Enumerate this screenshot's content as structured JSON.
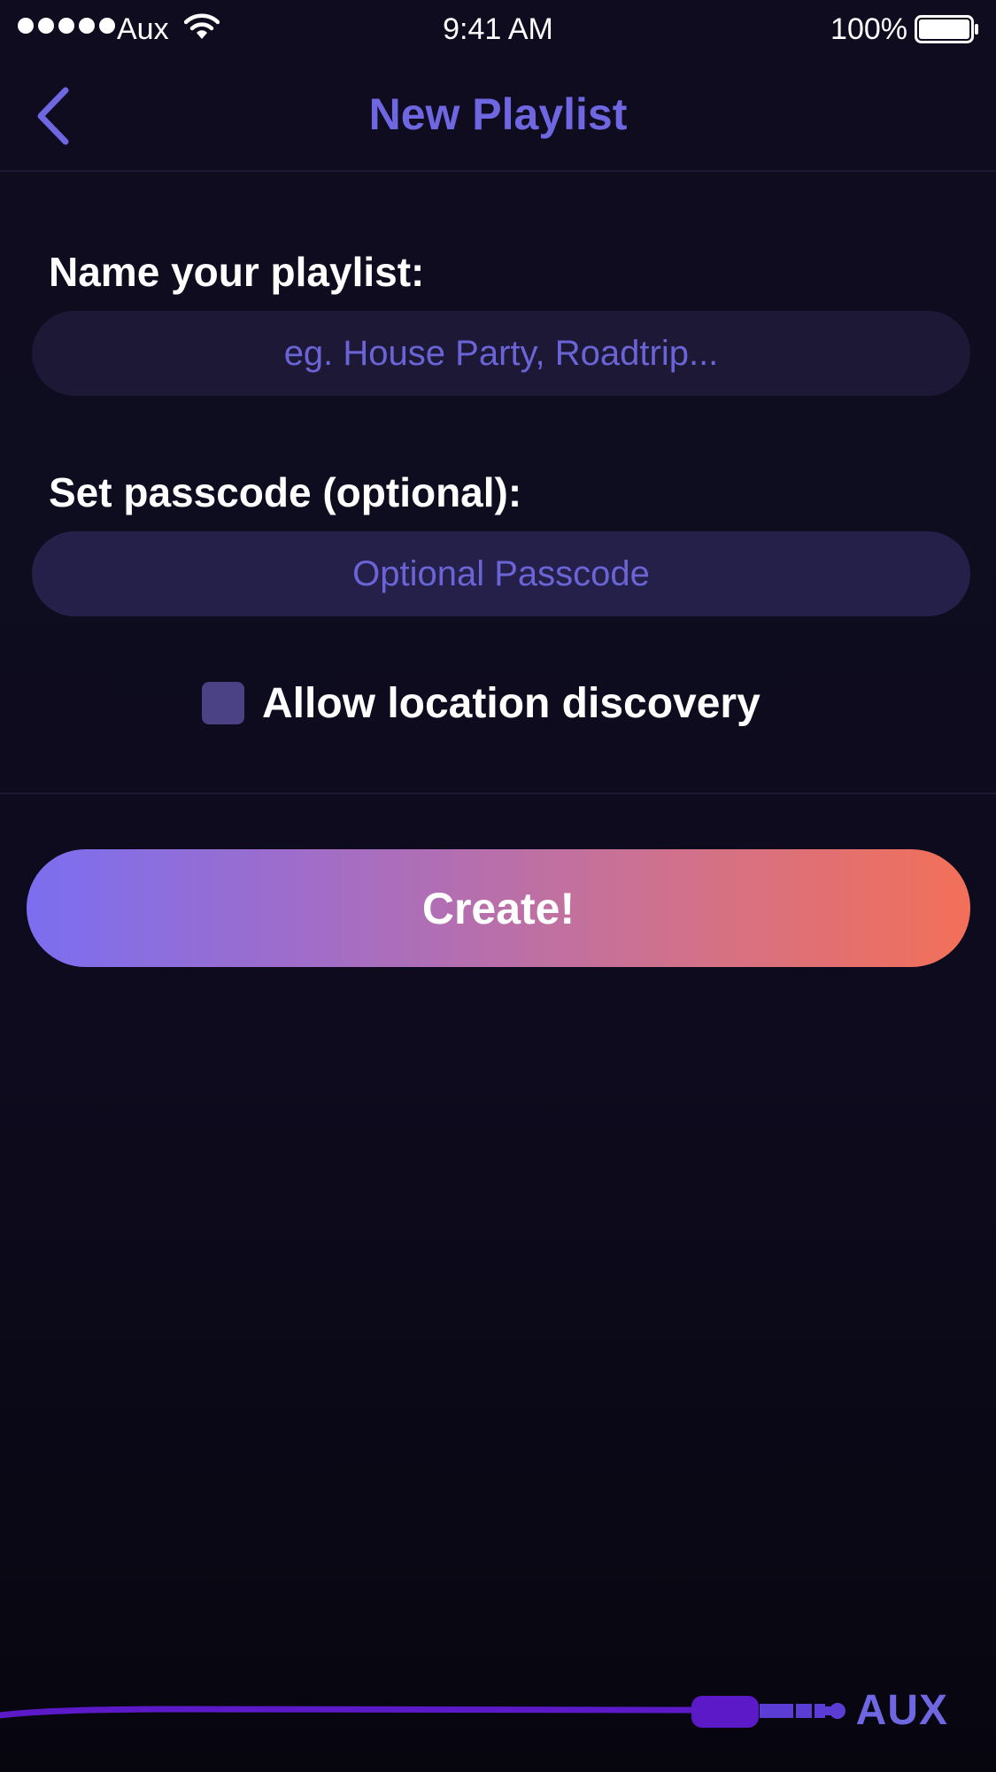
{
  "status_bar": {
    "carrier": "Aux",
    "time": "9:41 AM",
    "battery": "100%",
    "signal_bars": 5
  },
  "nav": {
    "title": "New Playlist",
    "back_icon": "chevron-left-icon"
  },
  "form": {
    "name_label": "Name your playlist:",
    "name_value": "",
    "name_placeholder": "eg. House Party, Roadtrip...",
    "passcode_label": "Set passcode (optional):",
    "passcode_value": "",
    "passcode_placeholder": "Optional Passcode",
    "location_label": "Allow location discovery",
    "location_checked": false
  },
  "create_button": {
    "label": "Create!"
  },
  "footer": {
    "brand": "AUX",
    "logo_icon": "aux-cable-icon"
  },
  "colors": {
    "background": "#0f0c20",
    "accent": "#6f67e2",
    "field_bg": "#1c1836",
    "field_bg_2": "#25204a",
    "checkbox": "#4b4185",
    "gradient_start": "#7b6ef0",
    "gradient_end": "#f37058",
    "cable": "#5b19c8"
  }
}
